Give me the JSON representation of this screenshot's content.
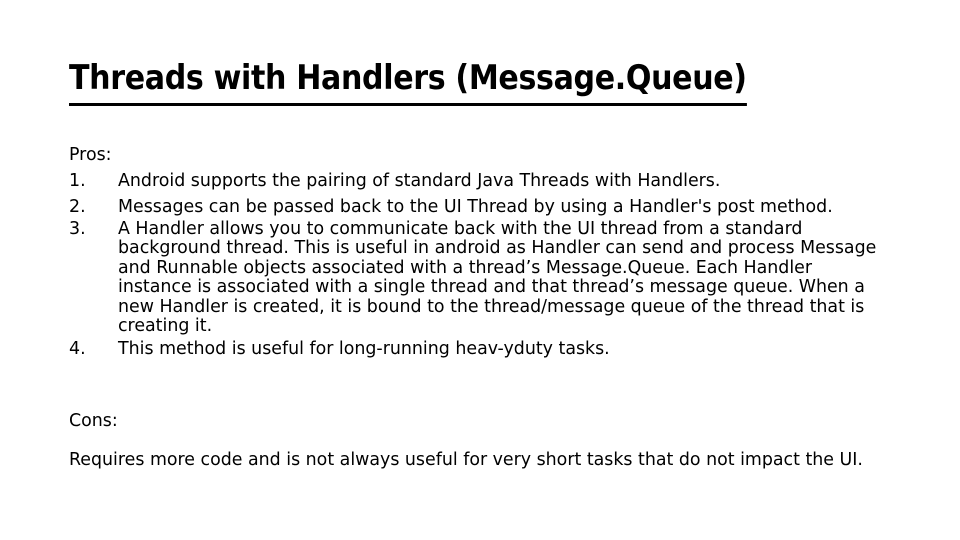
{
  "slide": {
    "title": "Threads with Handlers (Message.Queue)",
    "pros_label": "Pros:",
    "pros_items": [
      {
        "number": "1.",
        "text": "Android supports the pairing of standard Java Threads with Handlers."
      },
      {
        "number": "2.",
        "text": "Messages can be passed back to the UI Thread by using a Handler's post method."
      },
      {
        "number": "3.",
        "text": "A Handler allows you to communicate back with the UI thread from a standard background thread. This is useful in android as Handler can send and process Message and Runnable objects associated with a thread’s Message.Queue. Each Handler instance is associated with a single thread and that thread’s message queue. When a new Handler is created, it is bound to the thread/message queue of the thread that is creating it."
      },
      {
        "number": "4.",
        "text": "This method is useful for long-running heav-yduty tasks."
      }
    ],
    "cons_label": "Cons:",
    "cons_text": "Requires more code and is not always useful for very short tasks that do not impact the UI.",
    "colors": {
      "background": "#ffffff",
      "text": "#000000",
      "title": "#000000",
      "underline": "#000000"
    }
  }
}
